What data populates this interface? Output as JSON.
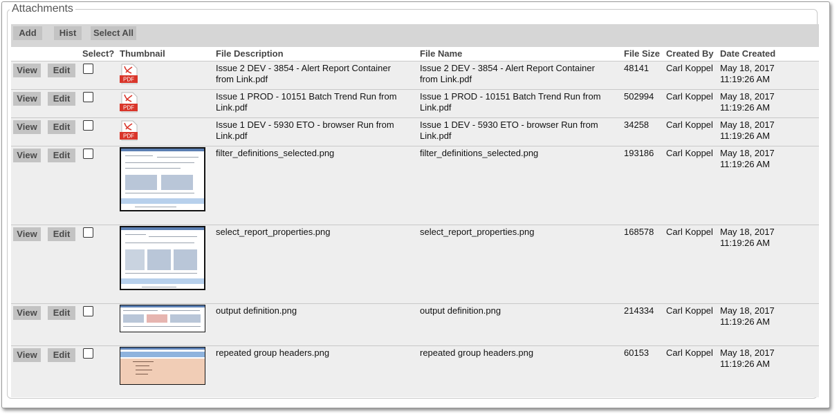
{
  "section": {
    "title": "Attachments"
  },
  "toolbar": {
    "add_label": "Add",
    "hist_label": "Hist",
    "select_all_label": "Select All"
  },
  "columns": {
    "select": "Select?",
    "thumbnail": "Thumbnail",
    "file_description": "File Description",
    "file_name": "File Name",
    "file_size": "File Size",
    "created_by": "Created By",
    "date_created": "Date Created"
  },
  "row_actions": {
    "view_label": "View",
    "edit_label": "Edit"
  },
  "pdf_label": "PDF",
  "rows": [
    {
      "description": "Issue 2 DEV - 3854 - Alert Report Container from Link.pdf",
      "file_name": "Issue 2 DEV - 3854 - Alert Report Container from Link.pdf",
      "size": "48141",
      "created_by": "Carl Koppel",
      "date": "May 18, 2017 11:19:26 AM",
      "thumbnail": "pdf-icon"
    },
    {
      "description": "Issue 1 PROD - 10151 Batch Trend Run from Link.pdf",
      "file_name": "Issue 1 PROD - 10151 Batch Trend Run from Link.pdf",
      "size": "502994",
      "created_by": "Carl Koppel",
      "date": "May 18, 2017 11:19:26 AM",
      "thumbnail": "pdf-icon"
    },
    {
      "description": "Issue 1 DEV - 5930 ETO - browser Run from Link.pdf",
      "file_name": "Issue 1 DEV - 5930 ETO - browser Run from Link.pdf",
      "size": "34258",
      "created_by": "Carl Koppel",
      "date": "May 18, 2017 11:19:26 AM",
      "thumbnail": "pdf-icon"
    },
    {
      "description": "filter_definitions_selected.png",
      "file_name": "filter_definitions_selected.png",
      "size": "193186",
      "created_by": "Carl Koppel",
      "date": "May 18, 2017 11:19:26 AM",
      "thumbnail": "image-thumbnail"
    },
    {
      "description": "select_report_properties.png",
      "file_name": "select_report_properties.png",
      "size": "168578",
      "created_by": "Carl Koppel",
      "date": "May 18, 2017 11:19:26 AM",
      "thumbnail": "image-thumbnail"
    },
    {
      "description": "output definition.png",
      "file_name": "output definition.png",
      "size": "214334",
      "created_by": "Carl Koppel",
      "date": "May 18, 2017 11:19:26 AM",
      "thumbnail": "image-thumbnail"
    },
    {
      "description": "repeated group headers.png",
      "file_name": "repeated group headers.png",
      "size": "60153",
      "created_by": "Carl Koppel",
      "date": "May 18, 2017 11:19:26 AM",
      "thumbnail": "image-thumbnail"
    }
  ]
}
